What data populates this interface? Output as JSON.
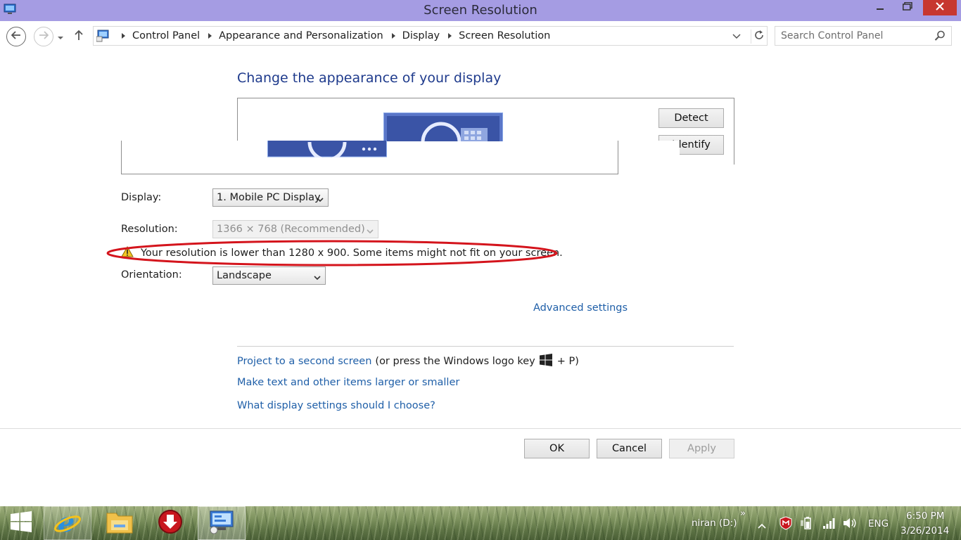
{
  "window": {
    "title": "Screen Resolution"
  },
  "address": {
    "breadcrumb": [
      "Control Panel",
      "Appearance and Personalization",
      "Display",
      "Screen Resolution"
    ],
    "search_placeholder": "Search Control Panel"
  },
  "main": {
    "heading": "Change the appearance of your display",
    "detect_label": "Detect",
    "identify_label": "Identify",
    "display_label": "Display:",
    "display_value": "1. Mobile PC Display",
    "resolution_label": "Resolution:",
    "resolution_value": "1366 × 768 (Recommended)",
    "warning_text": "Your resolution is lower than 1280 x 900. Some items might not fit on your screen.",
    "orientation_label": "Orientation:",
    "orientation_value": "Landscape",
    "advanced_link": "Advanced settings",
    "project_link": "Project to a second screen",
    "project_hint_pre": "(or press the Windows logo key",
    "project_hint_post": "+ P)",
    "larger_link": "Make text and other items larger or smaller",
    "which_link": "What display settings should I choose?"
  },
  "footer": {
    "ok_label": "OK",
    "cancel_label": "Cancel",
    "apply_label": "Apply"
  },
  "taskbar": {
    "toolbar_label": "niran (D:)",
    "toolbar_chevron": "»",
    "language": "ENG",
    "time": "6:50 PM",
    "date": "3/26/2014"
  },
  "colors": {
    "titlebar": "#a59ce3",
    "close_button": "#c7372f",
    "heading": "#1e3a8c",
    "link": "#1f5fa8",
    "annotation": "#d4141c"
  },
  "icons": [
    "display-app-icon",
    "minimize-icon",
    "maximize-icon",
    "close-icon",
    "back-arrow-icon",
    "forward-arrow-icon",
    "history-chevron-icon",
    "up-arrow-icon",
    "control-panel-icon",
    "refresh-icon",
    "search-icon",
    "warning-icon",
    "windows-logo-icon",
    "start-icon",
    "internet-explorer-icon",
    "file-explorer-icon",
    "download-icon",
    "control-panel-task-icon",
    "show-hidden-icons-icon",
    "mcafee-icon",
    "power-icon",
    "network-signal-icon",
    "volume-icon"
  ]
}
